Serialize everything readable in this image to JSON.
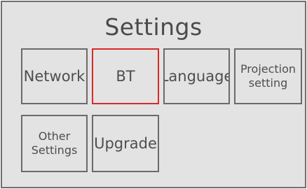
{
  "settings": {
    "title": "Settings",
    "selected": "bt",
    "colors": {
      "background": "#e3e3e3",
      "border": "#6a6a6a",
      "selected_border": "#d82a2a",
      "text": "#4e4e4e"
    },
    "tiles": {
      "network": {
        "label": "Network"
      },
      "bt": {
        "label": "BT"
      },
      "language": {
        "label": "Language"
      },
      "projection": {
        "label": "Projection\nsetting"
      },
      "other": {
        "label": "Other\nSettings"
      },
      "upgrade": {
        "label": "Upgrade"
      }
    }
  }
}
